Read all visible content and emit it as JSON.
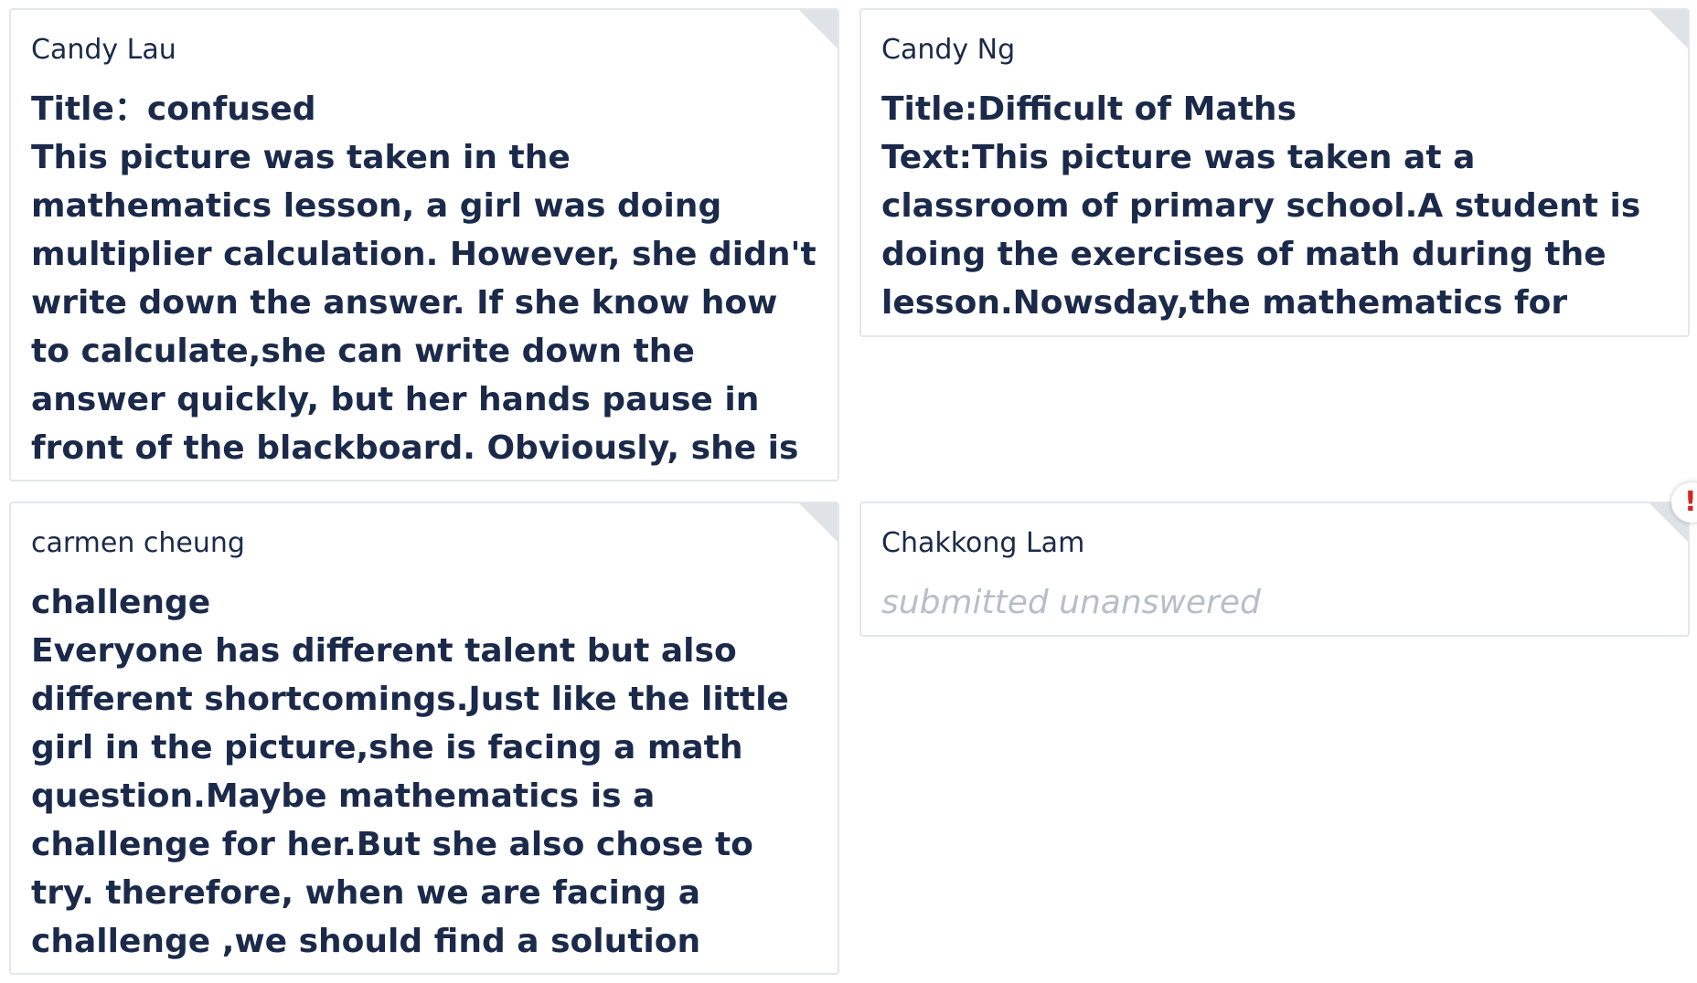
{
  "posts": [
    {
      "author": "Candy Lau",
      "title": "Title：confused",
      "body": "This picture was taken in the mathematics lesson, a girl was doing multiplier calculation. However, she didn't write down the answer. If she know how to calculate,she can write down the answer quickly, but her hands pause in front of the blackboard. Obviously, she is puzzled on the question."
    },
    {
      "author": "Candy Ng",
      "title": "Title:Difficult of Maths",
      "body": "Text:This picture was taken at a classroom of primary school.A student is doing the exercises of math during the lesson.Nowsday,the mathematics for students are very difficult."
    },
    {
      "author": "carmen cheung",
      "title": "challenge",
      "body": "Everyone has different talent but also different shortcomings.Just like the little girl in the picture,she is facing a math question.Maybe mathematics is a challenge for her.But she also chose to try. therefore, when we are facing a challenge ,we should find a solution instead of avoiding it ."
    },
    {
      "author": "Chakkong Lam",
      "status": "submitted unanswered"
    }
  ],
  "alert_badge": "!",
  "colors": {
    "text": "#1b2a4a",
    "muted": "#b7bec8",
    "border": "#e3e6ea",
    "alert": "#d6261e"
  }
}
